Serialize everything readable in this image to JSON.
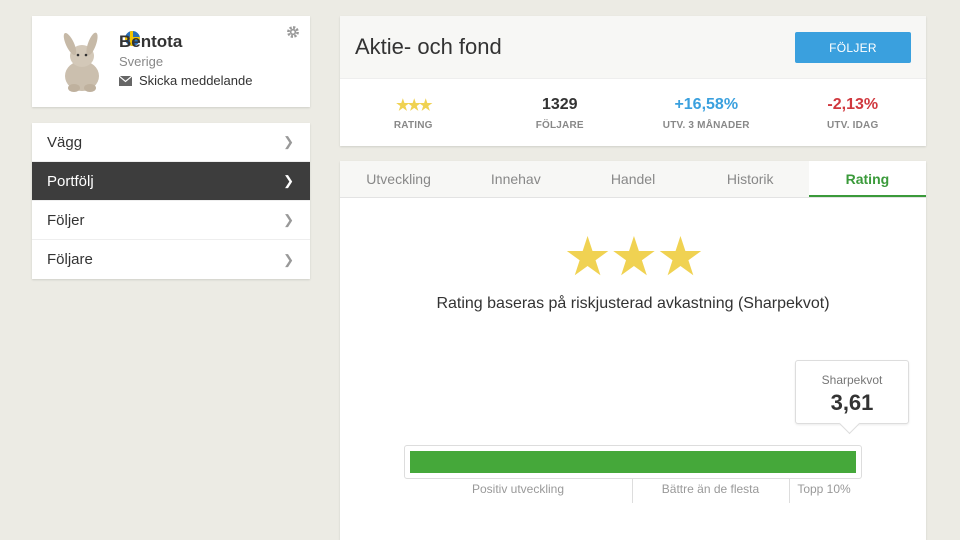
{
  "profile": {
    "name": "Bentota",
    "country": "Sverige",
    "message_link": "Skicka meddelande"
  },
  "nav": {
    "items": [
      {
        "label": "Vägg"
      },
      {
        "label": "Portfölj"
      },
      {
        "label": "Följer"
      },
      {
        "label": "Följare"
      }
    ],
    "active_index": 1
  },
  "header": {
    "title": "Aktie- och fond",
    "follow_button": "FÖLJER",
    "stats": [
      {
        "value": "★★★",
        "label": "RATING",
        "color": "#f0d252"
      },
      {
        "value": "1329",
        "label": "FÖLJARE",
        "color": "#333333"
      },
      {
        "value": "+16,58%",
        "label": "UTV. 3 MÅNADER",
        "color": "#3aa0de"
      },
      {
        "value": "-2,13%",
        "label": "UTV. IDAG",
        "color": "#d0383e"
      }
    ]
  },
  "tabs": [
    {
      "label": "Utveckling"
    },
    {
      "label": "Innehav"
    },
    {
      "label": "Handel"
    },
    {
      "label": "Historik"
    },
    {
      "label": "Rating"
    }
  ],
  "active_tab_index": 4,
  "rating": {
    "stars": "★★★",
    "description": "Rating baseras på riskjusterad avkastning (Sharpekvot)",
    "sharpe_label": "Sharpekvot",
    "sharpe_value": "3,61",
    "bar_fill_percent": 100,
    "segments": [
      {
        "label": "Positiv utveckling"
      },
      {
        "label": "Bättre än de flesta"
      },
      {
        "label": "Topp 10%"
      }
    ]
  },
  "colors": {
    "accent_blue": "#3aa0de",
    "accent_green": "#45a83a",
    "negative_red": "#d0383e",
    "star_yellow": "#f0d252"
  }
}
